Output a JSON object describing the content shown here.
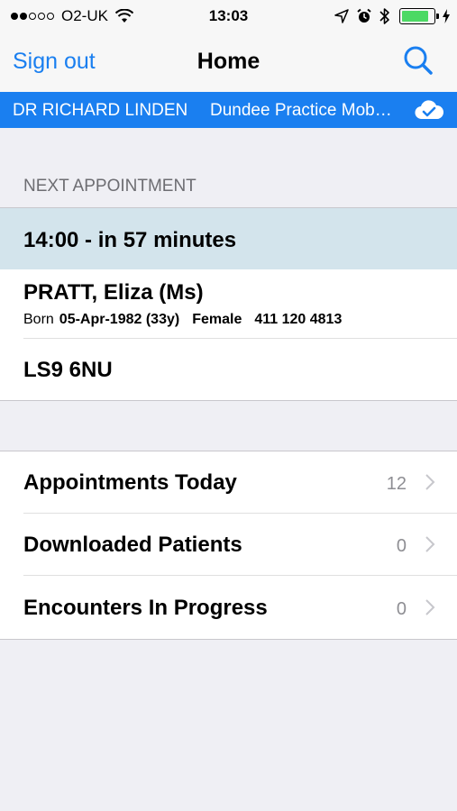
{
  "status_bar": {
    "carrier": "O2-UK",
    "time": "13:03",
    "signal_full_dots": 2,
    "signal_empty_dots": 3,
    "battery_level": 0.85
  },
  "nav": {
    "left_label": "Sign out",
    "title": "Home",
    "right_icon": "search-icon"
  },
  "user_strip": {
    "user_name": "DR RICHARD LINDEN",
    "practice": "Dundee Practice Mob…",
    "icon": "cloud-check-icon"
  },
  "next_appointment": {
    "header": "NEXT APPOINTMENT",
    "time_text": "14:00 - in 57 minutes",
    "patient_name": "PRATT, Eliza (Ms)",
    "born_label": "Born",
    "dob": "05-Apr-1982 (33y)",
    "gender": "Female",
    "nhs_number": "411 120 4813",
    "postcode": "LS9 6NU"
  },
  "menu": {
    "items": [
      {
        "label": "Appointments Today",
        "count": "12"
      },
      {
        "label": "Downloaded Patients",
        "count": "0"
      },
      {
        "label": "Encounters In Progress",
        "count": "0"
      }
    ]
  },
  "colors": {
    "accent": "#1a7ff0",
    "appointment_highlight": "#d3e4ec",
    "background": "#efeff4"
  }
}
